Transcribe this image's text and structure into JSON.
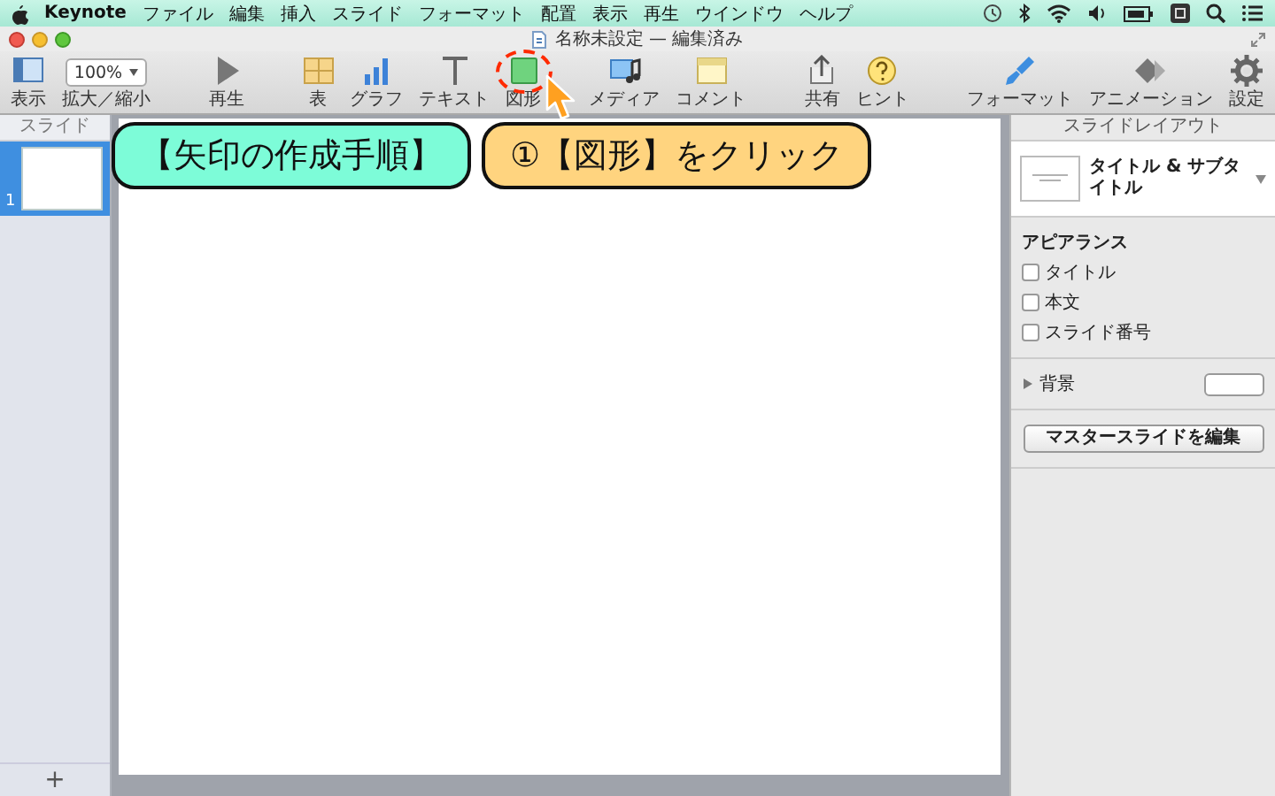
{
  "menu_bar": {
    "app": "Keynote",
    "items": [
      "ファイル",
      "編集",
      "挿入",
      "スライド",
      "フォーマット",
      "配置",
      "表示",
      "再生",
      "ウインドウ",
      "ヘルプ"
    ]
  },
  "window": {
    "title": "名称未設定 — 編集済み"
  },
  "toolbar": {
    "groups": [
      [
        {
          "kind": "view",
          "label": "表示",
          "circled": false
        },
        {
          "kind": "zoom",
          "label": "拡大／縮小",
          "value": "100%",
          "circled": false
        }
      ],
      [
        {
          "kind": "play",
          "label": "再生",
          "circled": false
        }
      ],
      [
        {
          "kind": "table",
          "label": "表",
          "circled": false
        },
        {
          "kind": "chart",
          "label": "グラフ",
          "circled": false
        },
        {
          "kind": "text",
          "label": "テキスト",
          "circled": false
        },
        {
          "kind": "shape",
          "label": "図形",
          "circled": true
        },
        {
          "kind": "media",
          "label": "メディア",
          "circled": false
        },
        {
          "kind": "comment",
          "label": "コメント",
          "circled": false
        }
      ],
      [
        {
          "kind": "share",
          "label": "共有",
          "circled": false
        },
        {
          "kind": "hint",
          "label": "ヒント",
          "circled": false
        }
      ],
      [
        {
          "kind": "format",
          "label": "フォーマット",
          "circled": false
        },
        {
          "kind": "animation",
          "label": "アニメーション",
          "circled": false
        },
        {
          "kind": "settings",
          "label": "設定",
          "circled": false
        }
      ]
    ]
  },
  "sidebar": {
    "header": "スライド",
    "slides": [
      {
        "number": "1",
        "selected": true
      }
    ],
    "add_button": "+"
  },
  "callouts": [
    {
      "text": "【矢印の作成手順】",
      "color": "#7dfcd8"
    },
    {
      "text": "①【図形】をクリック",
      "color": "#ffd47f"
    }
  ],
  "inspector": {
    "header": "スライドレイアウト",
    "layout": "タイトル & サブタイトル",
    "appearance": {
      "heading": "アピアランス",
      "options": [
        {
          "label": "タイトル",
          "checked": false
        },
        {
          "label": "本文",
          "checked": false
        },
        {
          "label": "スライド番号",
          "checked": false
        }
      ]
    },
    "background": {
      "label": "背景",
      "expanded": false
    },
    "button": "マスタースライドを編集"
  }
}
